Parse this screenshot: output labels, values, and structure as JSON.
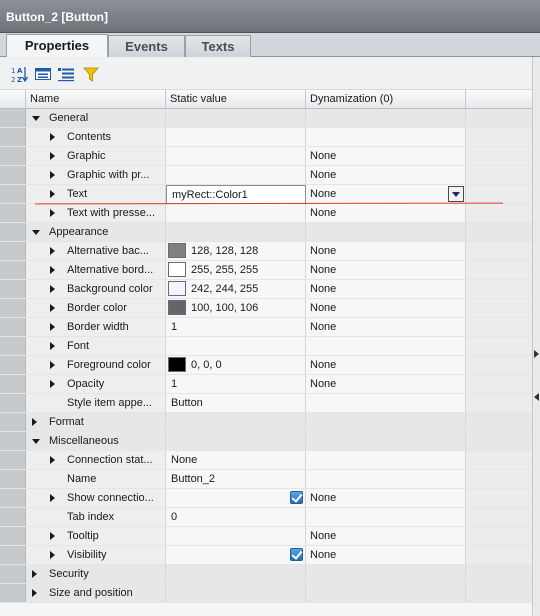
{
  "window": {
    "title": "Button_2 [Button]"
  },
  "tabs": [
    {
      "label": "Properties"
    },
    {
      "label": "Events"
    },
    {
      "label": "Texts"
    }
  ],
  "toolbar": {
    "icons": [
      "sort-az-icon",
      "categorized-view-icon",
      "list-view-icon",
      "filter-icon"
    ]
  },
  "grid": {
    "columns": {
      "name": "Name",
      "static_value": "Static value",
      "dynamization": "Dynamization (0)"
    },
    "rows": [
      {
        "level": 0,
        "expand": "down",
        "name": "General",
        "value": "",
        "dyn": ""
      },
      {
        "level": 1,
        "expand": "right",
        "name": "Contents",
        "value": "",
        "dyn": ""
      },
      {
        "level": 1,
        "expand": "right",
        "name": "Graphic",
        "value": "",
        "dyn": "None"
      },
      {
        "level": 1,
        "expand": "right",
        "name": "Graphic with pr...",
        "value": "",
        "dyn": "None"
      },
      {
        "level": 1,
        "expand": "right",
        "name": "Text",
        "value": "myRect::Color1",
        "dyn": "None",
        "editing": true
      },
      {
        "level": 1,
        "expand": "right",
        "name": "Text with presse...",
        "value": "",
        "dyn": "None"
      },
      {
        "level": 0,
        "expand": "down",
        "name": "Appearance",
        "value": "",
        "dyn": ""
      },
      {
        "level": 1,
        "expand": "right",
        "name": "Alternative bac...",
        "swatch": "#808080",
        "value": "128, 128, 128",
        "dyn": "None"
      },
      {
        "level": 1,
        "expand": "right",
        "name": "Alternative bord...",
        "swatch": "#ffffff",
        "value": "255, 255, 255",
        "dyn": "None"
      },
      {
        "level": 1,
        "expand": "right",
        "name": "Background color",
        "swatch": "#f2f4ff",
        "value": "242, 244, 255",
        "dyn": "None"
      },
      {
        "level": 1,
        "expand": "right",
        "name": "Border color",
        "swatch": "#64646a",
        "value": "100, 100, 106",
        "dyn": "None"
      },
      {
        "level": 1,
        "expand": "right",
        "name": "Border width",
        "value": "1",
        "dyn": "None"
      },
      {
        "level": 1,
        "expand": "right",
        "name": "Font",
        "value": "",
        "dyn": ""
      },
      {
        "level": 1,
        "expand": "right",
        "name": "Foreground color",
        "swatch": "#000000",
        "value": "0, 0, 0",
        "dyn": "None"
      },
      {
        "level": 1,
        "expand": "right",
        "name": "Opacity",
        "value": "1",
        "dyn": "None"
      },
      {
        "level": 1,
        "expand": "",
        "name": "Style item appe...",
        "value": "Button",
        "dyn": ""
      },
      {
        "level": 0,
        "expand": "right",
        "name": "Format",
        "value": "",
        "dyn": ""
      },
      {
        "level": 0,
        "expand": "down",
        "name": "Miscellaneous",
        "value": "",
        "dyn": ""
      },
      {
        "level": 1,
        "expand": "right",
        "name": "Connection stat...",
        "value": "None",
        "dyn": ""
      },
      {
        "level": 1,
        "expand": "",
        "name": "Name",
        "value": "Button_2",
        "dyn": ""
      },
      {
        "level": 1,
        "expand": "right",
        "name": "Show connectio...",
        "value": "",
        "checked": true,
        "dyn": "None"
      },
      {
        "level": 1,
        "expand": "",
        "name": "Tab index",
        "value": "0",
        "dyn": ""
      },
      {
        "level": 1,
        "expand": "right",
        "name": "Tooltip",
        "value": "",
        "dyn": "None"
      },
      {
        "level": 1,
        "expand": "right",
        "name": "Visibility",
        "value": "",
        "checked": true,
        "dyn": "None"
      },
      {
        "level": 0,
        "expand": "right",
        "name": "Security",
        "value": "",
        "dyn": ""
      },
      {
        "level": 0,
        "expand": "right",
        "name": "Size and position",
        "value": "",
        "dyn": ""
      }
    ]
  },
  "colors": {
    "accent_checkbox": "#1f6cb8",
    "annotation_line": "#e53b2f"
  }
}
